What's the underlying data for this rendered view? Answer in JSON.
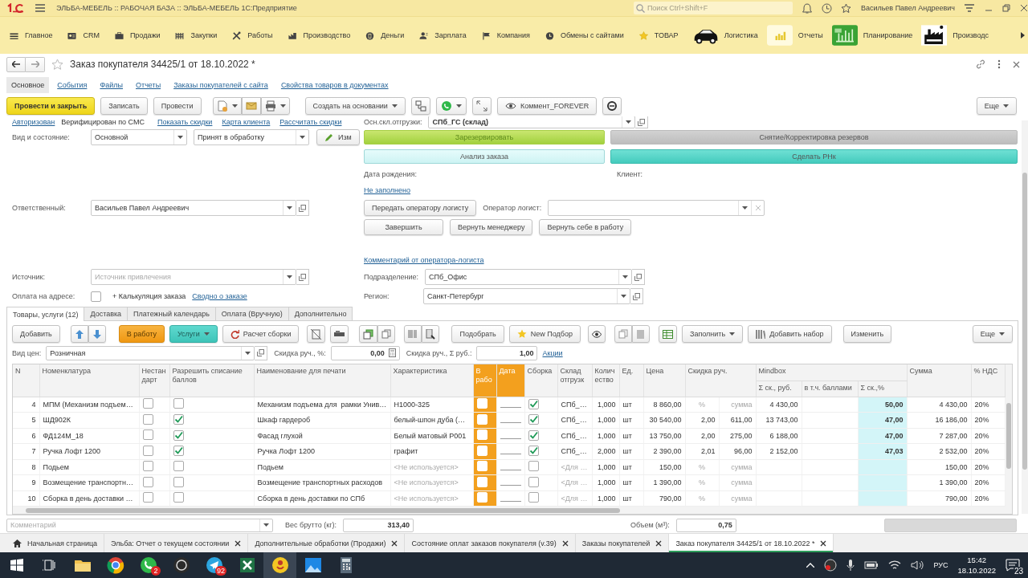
{
  "app_bar": {
    "title": "ЭЛЬБА-МЕБЕЛЬ :: РАБОЧАЯ БАЗА :: ЭЛЬБА-МЕБЕЛЬ 1С:Предприятие",
    "search": {
      "placeholder": "Поиск Ctrl+Shift+F"
    },
    "user": "Васильев Павел Андреевич"
  },
  "sections": [
    {
      "label": "Главное",
      "kind": "small"
    },
    {
      "label": "CRM",
      "kind": "small"
    },
    {
      "label": "Продажи",
      "kind": "small"
    },
    {
      "label": "Закупки",
      "kind": "small"
    },
    {
      "label": "Работы",
      "kind": "small"
    },
    {
      "label": "Производство",
      "kind": "small"
    },
    {
      "label": "Деньги",
      "kind": "small"
    },
    {
      "label": "Зарплата",
      "kind": "small"
    },
    {
      "label": "Компания",
      "kind": "small"
    },
    {
      "label": "Обмены с сайтами",
      "kind": "small"
    },
    {
      "label": "ТОВАР",
      "kind": "small"
    },
    {
      "label": "Логистика",
      "kind": "large"
    },
    {
      "label": "Отчеты",
      "kind": "large"
    },
    {
      "label": "Планирование",
      "kind": "large"
    },
    {
      "label": "Производс",
      "kind": "large"
    }
  ],
  "form": {
    "title": "Заказ покупателя 34425/1 от 18.10.2022 *",
    "nav": [
      {
        "label": "Основное",
        "selected": true
      },
      {
        "label": "События",
        "selected": false
      },
      {
        "label": "Файлы",
        "selected": false
      },
      {
        "label": "Отчеты",
        "selected": false
      },
      {
        "label": "Заказы покупателей с сайта",
        "selected": false
      },
      {
        "label": "Свойства товаров в документах",
        "selected": false
      }
    ],
    "command_bar": {
      "post_and_close": "Провести и закрыть",
      "save": "Записать",
      "post": "Провести",
      "create_based_on": "Создать на основании",
      "comment": "Коммент_FOREVER",
      "more": "Еще"
    },
    "header_links": {
      "authorized": "Авторизован",
      "verified": "Верифицирован по СМС",
      "links": [
        "Показать скидки",
        "Карта клиента",
        "Рассчитать скидки"
      ]
    },
    "main": {
      "kind_state": {
        "label": "Вид и состояние:",
        "kind": "Основной",
        "state": "Принят в обработку",
        "edit": "Изм"
      },
      "responsible": {
        "label": "Ответственный:",
        "value": "Васильев Павел Андреевич"
      },
      "source": {
        "label": "Источник:",
        "placeholder": "Источник привлечения"
      },
      "payment_on_address": {
        "label": "Оплата на адресе:",
        "checked": false,
        "calculation": "+ Калькуляция заказа",
        "summary": "Сводно о заказе"
      },
      "warehouse": {
        "label": "Осн.скл.отгрузки:",
        "value": "СПб_ГС (склад)"
      },
      "reserve": {
        "label": "Зарезервировать",
        "disabled": true
      },
      "unreserve": "Снятие/Корректировка резервов",
      "analysis": "Анализ заказа",
      "make_rnk": "Сделать РНк",
      "birth_date": {
        "label": "Дата рождения:",
        "value": "Не заполнено"
      },
      "client": {
        "label": "Клиент:"
      },
      "logistics": {
        "send": "Передать оператору логисту",
        "operator_label": "Оператор логист:",
        "finish": "Завершить",
        "return_manager": "Вернуть менеджеру",
        "return_self": "Вернуть себе в работу",
        "comment_link": "Комментарий от оператора-логиста"
      },
      "division": {
        "label": "Подразделение:",
        "value": "СПб_Офис"
      },
      "region": {
        "label": "Регион:",
        "value": "Санкт-Петербург"
      }
    },
    "tabs": [
      {
        "label": "Товары, услуги (12)",
        "selected": true
      },
      {
        "label": "Доставка",
        "selected": false
      },
      {
        "label": "Платежный календарь",
        "selected": false
      },
      {
        "label": "Оплата (Вручную)",
        "selected": false
      },
      {
        "label": "Дополнительно",
        "selected": false
      }
    ],
    "goods": {
      "toolbar": {
        "add": "Добавить",
        "to_work": "В работу",
        "services": "Услуги",
        "assembly_calc": "Расчет сборки",
        "pick": "Подобрать",
        "new_pick": "New Подбор",
        "fill": "Заполнить",
        "add_set": "Добавить набор",
        "change": "Изменить",
        "more": "Еще"
      },
      "price_bar": {
        "price_type_label": "Вид цен:",
        "price_type": "Розничная",
        "discount_pct_label": "Скидка руч., %:",
        "discount_pct": "0,00",
        "discount_sum_label": "Скидка руч., Σ руб.:",
        "discount_sum": "1,00",
        "promo": "Акции"
      },
      "table": {
        "columns": [
          {
            "label": "N"
          },
          {
            "label": "Номенклатура"
          },
          {
            "label": "Нестандарт"
          },
          {
            "label": "Разрешить списание баллов"
          },
          {
            "label": "Наименование для печати"
          },
          {
            "label": "Характеристика"
          },
          {
            "label": "В рабо"
          },
          {
            "label": "Дата"
          },
          {
            "label": "Сборка"
          },
          {
            "label": "Склад отгрузк"
          },
          {
            "label": "Количество"
          },
          {
            "label": "Ед."
          },
          {
            "label": "Цена"
          },
          {
            "label": "Скидка руч."
          },
          {
            "label": "Mindbox",
            "children": [
              {
                "label": "Σ ск., руб."
              },
              {
                "label": "в т.ч. баллами"
              },
              {
                "label": "Σ ск.,%"
              }
            ]
          },
          {
            "label": "Сумма"
          },
          {
            "label": "% НДС"
          }
        ],
        "rows": [
          {
            "n": "4",
            "item": "МПМ (Механизм подъем…",
            "nonstandard": false,
            "allow_points": false,
            "print_name": "Механизм подъема для  рамки Унив…",
            "characteristic": "Н1000-325",
            "in_work": false,
            "assembly": true,
            "warehouse": "СПб_…",
            "inactive": false,
            "qty": "1,000",
            "unit": "шт",
            "price": "8 860,00",
            "discount": {
              "percent_placeholder": "%",
              "amount_placeholder": "сумма"
            },
            "mb_rub": "4 430,00",
            "mb_pct": "50,00",
            "sum": "4 430,00",
            "vat": "20%"
          },
          {
            "n": "5",
            "item": "ШД902К",
            "nonstandard": false,
            "allow_points": true,
            "print_name": "Шкаф гардероб",
            "characteristic": "белый-шпон дуба (…",
            "in_work": false,
            "assembly": true,
            "warehouse": "СПб_…",
            "inactive": false,
            "qty": "1,000",
            "unit": "шт",
            "price": "30 540,00",
            "discount": {
              "percent": "2,00",
              "amount": "611,00"
            },
            "mb_rub": "13 743,00",
            "mb_pct": "47,00",
            "sum": "16 186,00",
            "vat": "20%"
          },
          {
            "n": "6",
            "item": "ФД124М_18",
            "nonstandard": false,
            "allow_points": true,
            "print_name": "Фасад глухой",
            "characteristic": "Белый матовый Р001",
            "in_work": false,
            "assembly": true,
            "warehouse": "СПб_…",
            "inactive": false,
            "qty": "1,000",
            "unit": "шт",
            "price": "13 750,00",
            "discount": {
              "percent": "2,00",
              "amount": "275,00"
            },
            "mb_rub": "6 188,00",
            "mb_pct": "47,00",
            "sum": "7 287,00",
            "vat": "20%"
          },
          {
            "n": "7",
            "item": "Ручка Лофт 1200",
            "nonstandard": false,
            "allow_points": true,
            "print_name": "Ручка Лофт 1200",
            "characteristic": "графит",
            "in_work": false,
            "assembly": true,
            "warehouse": "СПб_…",
            "inactive": false,
            "qty": "2,000",
            "unit": "шт",
            "price": "2 390,00",
            "discount": {
              "percent": "2,01",
              "amount": "96,00"
            },
            "mb_rub": "2 152,00",
            "mb_pct": "47,03",
            "sum": "2 532,00",
            "vat": "20%"
          },
          {
            "n": "8",
            "item": "Подьем",
            "nonstandard": false,
            "allow_points": false,
            "print_name": "Подьем",
            "characteristic": "<Не используется>",
            "in_work": false,
            "assembly": false,
            "warehouse": "<Для …",
            "inactive": true,
            "qty": "1,000",
            "unit": "шт",
            "price": "150,00",
            "discount": {
              "percent_placeholder": "%",
              "amount_placeholder": "сумма"
            },
            "sum": "150,00",
            "vat": "20%"
          },
          {
            "n": "9",
            "item": "Возмещение транспортн…",
            "nonstandard": false,
            "allow_points": false,
            "print_name": "Возмещение транспортных расходов",
            "characteristic": "<Не используется>",
            "in_work": false,
            "assembly": false,
            "warehouse": "<Для …",
            "inactive": true,
            "qty": "1,000",
            "unit": "шт",
            "price": "1 390,00",
            "discount": {
              "percent_placeholder": "%",
              "amount_placeholder": "сумма"
            },
            "sum": "1 390,00",
            "vat": "20%"
          },
          {
            "n": "10",
            "item": "Сборка в день доставки …",
            "nonstandard": false,
            "allow_points": false,
            "print_name": "Сборка в день доставки по СПб",
            "characteristic": "<Не используется>",
            "in_work": false,
            "assembly": false,
            "warehouse": "<Для …",
            "inactive": true,
            "qty": "1,000",
            "unit": "шт",
            "price": "790,00",
            "discount": {
              "percent_placeholder": "%",
              "amount_placeholder": "сумма"
            },
            "sum": "790,00",
            "vat": "20%"
          }
        ]
      }
    },
    "footer": {
      "comment_placeholder": "Комментарий",
      "weight_label": "Вес брутто (кг):",
      "weight": "313,40",
      "volume_label": "Объем (м³):",
      "volume": "0,75"
    }
  },
  "open_windows": [
    {
      "label": "Начальная страница",
      "kind": "home",
      "selected": false
    },
    {
      "label": "Эльба: Отчет о текущем состоянии",
      "kind": "window",
      "selected": false
    },
    {
      "label": "Дополнительные обработки (Продажи)",
      "kind": "window",
      "selected": false
    },
    {
      "label": "Состояние оплат заказов покупателя (v.39)",
      "kind": "window",
      "selected": false
    },
    {
      "label": "Заказы покупателей",
      "kind": "window",
      "selected": false
    },
    {
      "label": "Заказ покупателя 34425/1 от 18.10.2022 *",
      "kind": "window",
      "selected": true
    }
  ],
  "taskbar": {
    "apps": [
      {
        "selected": false
      },
      {
        "selected": false
      },
      {
        "selected": false,
        "badge": "2"
      },
      {
        "selected": false
      },
      {
        "selected": false,
        "badge": "92"
      },
      {
        "selected": false
      },
      {
        "selected": true
      },
      {
        "selected": false
      },
      {
        "selected": false
      }
    ],
    "language": "РУС",
    "time": "15:42",
    "date": "18.10.2022",
    "notifications": "23"
  }
}
